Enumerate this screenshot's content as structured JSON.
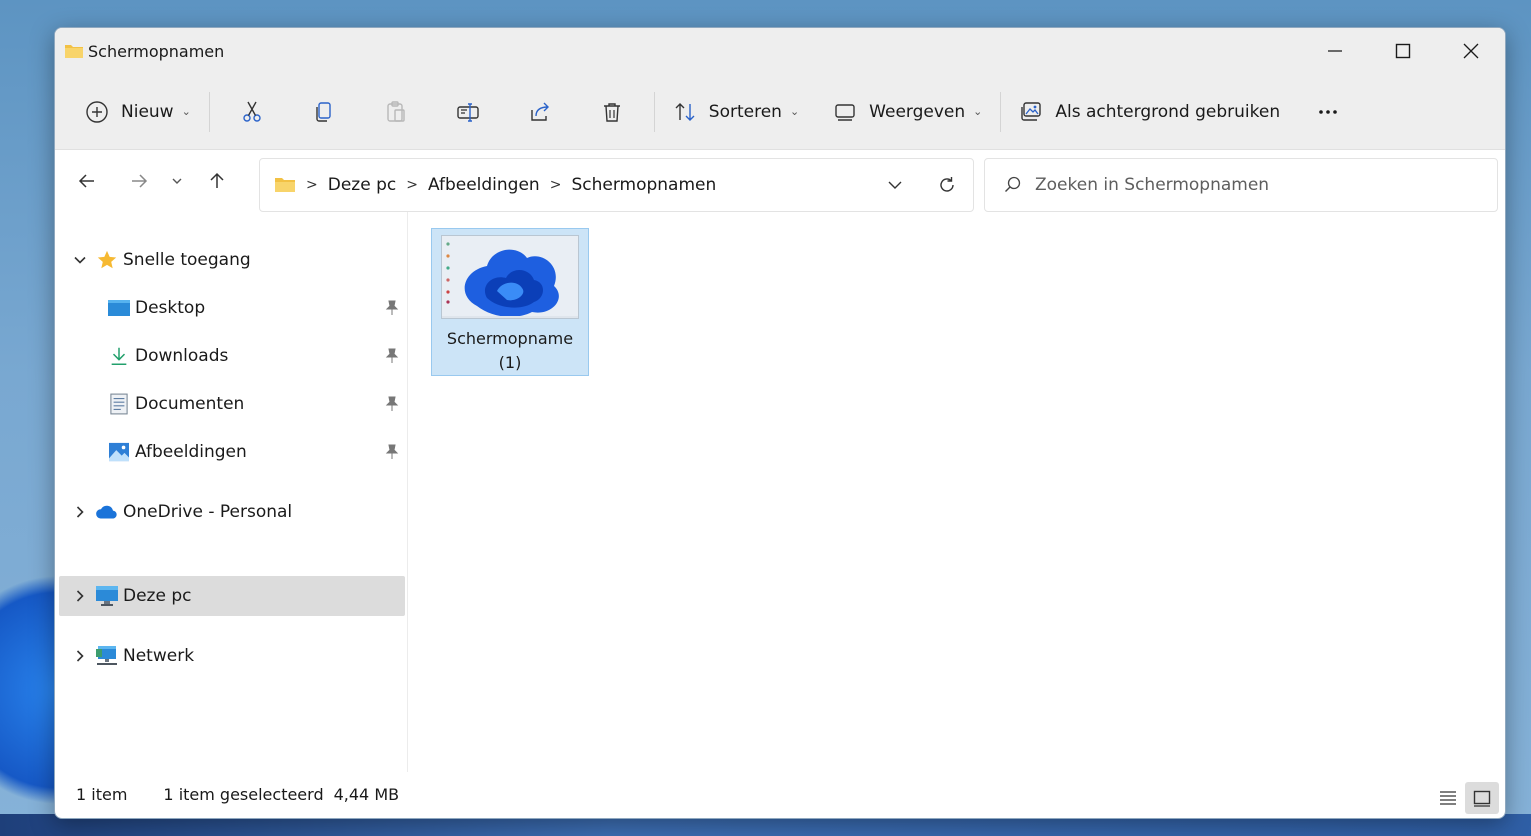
{
  "window": {
    "title": "Schermopnamen"
  },
  "toolbar": {
    "new_label": "Nieuw",
    "sort_label": "Sorteren",
    "view_label": "Weergeven",
    "wallpaper_label": "Als achtergrond gebruiken"
  },
  "address": {
    "crumbs": [
      "Deze pc",
      "Afbeeldingen",
      "Schermopnamen"
    ]
  },
  "search": {
    "placeholder": "Zoeken in Schermopnamen"
  },
  "sidebar": {
    "quick_access": "Snelle toegang",
    "items": [
      {
        "label": "Desktop"
      },
      {
        "label": "Downloads"
      },
      {
        "label": "Documenten"
      },
      {
        "label": "Afbeeldingen"
      }
    ],
    "onedrive": "OneDrive - Personal",
    "this_pc": "Deze pc",
    "network": "Netwerk"
  },
  "files": [
    {
      "name_line1": "Schermopname",
      "name_line2": "(1)"
    }
  ],
  "status": {
    "count": "1 item",
    "selected": "1 item geselecteerd",
    "size": "4,44 MB"
  },
  "colors": {
    "selection": "#cce4f7",
    "selection_border": "#99c9ef",
    "chrome": "#eeeeee",
    "folder": "#f2c144"
  }
}
